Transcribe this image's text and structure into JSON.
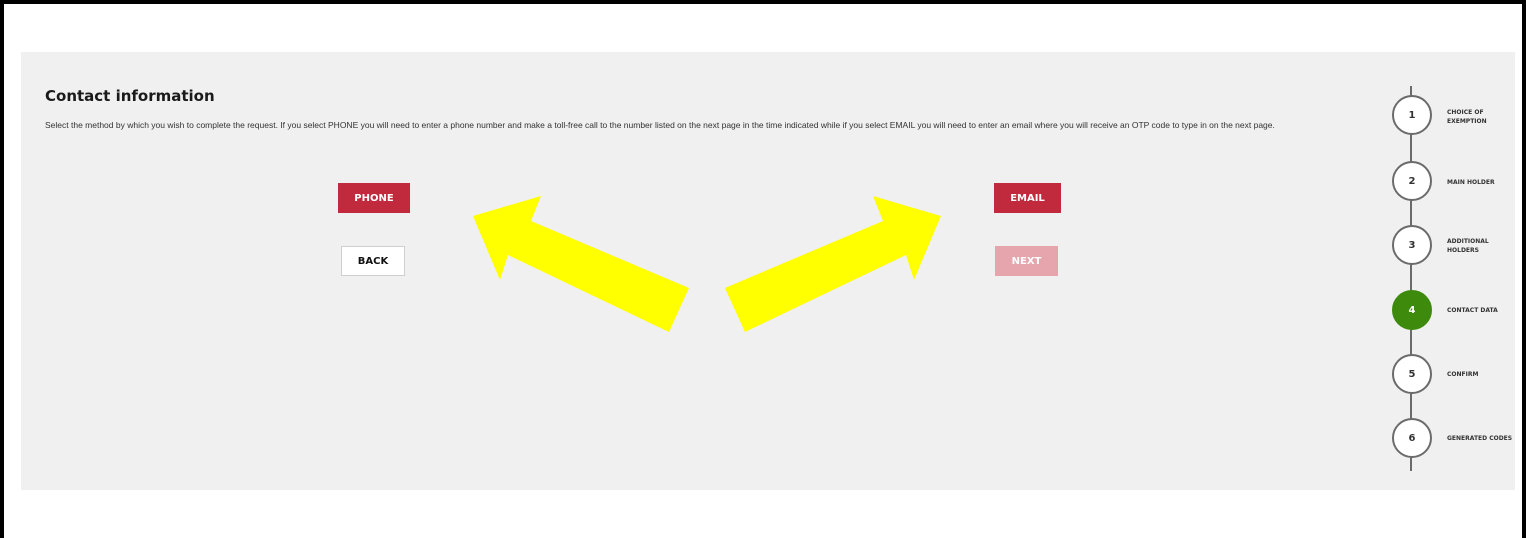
{
  "form": {
    "title": "Contact information",
    "description": "Select the method by which you wish to complete the request. If you select PHONE you will need to enter a phone number and make a toll-free call to the number listed on the next page in the time indicated while if you select EMAIL you will need to enter an email where you will receive an OTP code to type in on the next page.",
    "phone_label": "PHONE",
    "email_label": "EMAIL",
    "back_label": "BACK",
    "next_label": "NEXT"
  },
  "colors": {
    "primary": "#c1293c",
    "primary_disabled": "#e6a5ad",
    "active_step": "#3d8a0c",
    "annotation_arrow": "#ffff00"
  },
  "steps": [
    {
      "number": "1",
      "label": "CHOICE OF EXEMPTION",
      "active": false
    },
    {
      "number": "2",
      "label": "MAIN HOLDER",
      "active": false
    },
    {
      "number": "3",
      "label": "ADDITIONAL HOLDERS",
      "active": false
    },
    {
      "number": "4",
      "label": "CONTACT DATA",
      "active": true
    },
    {
      "number": "5",
      "label": "CONFIRM",
      "active": false
    },
    {
      "number": "6",
      "label": "GENERATED CODES",
      "active": false
    }
  ]
}
